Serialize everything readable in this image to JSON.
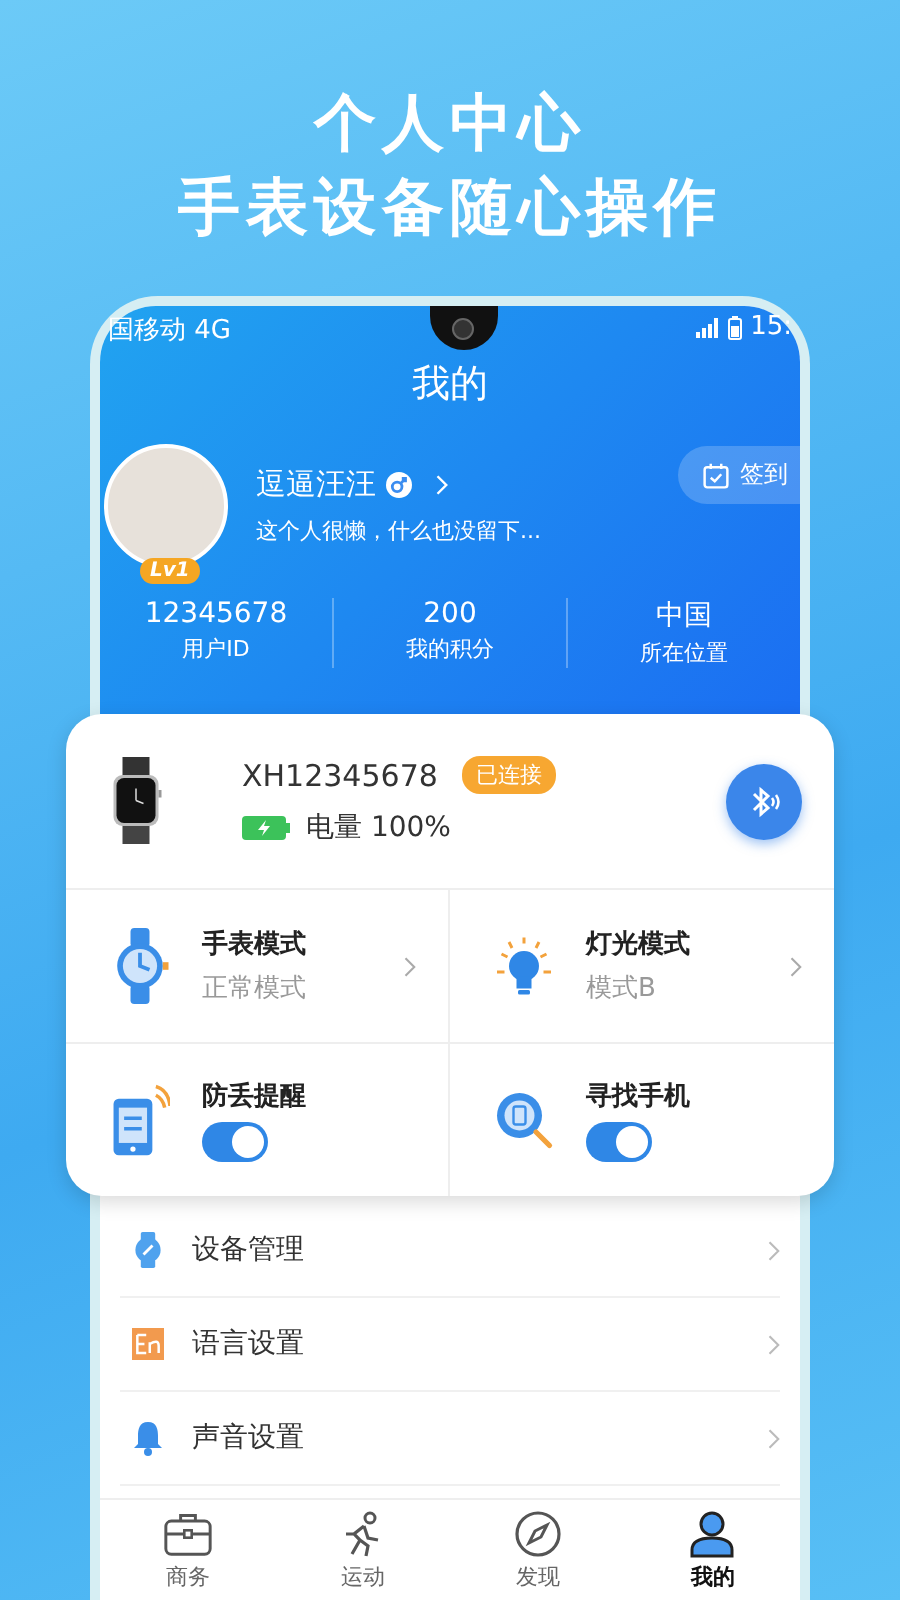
{
  "headline": [
    "个人中心",
    "手表设备随心操作"
  ],
  "status_bar": {
    "carrier": "国移动 4G",
    "time": "15:"
  },
  "title": "我的",
  "profile": {
    "name": "逗逼汪汪",
    "bio": "这个人很懒，什么也没留下...",
    "level": "Lv1",
    "checkin": "签到"
  },
  "stats": [
    {
      "value": "12345678",
      "label": "用户ID"
    },
    {
      "value": "200",
      "label": "我的积分"
    },
    {
      "value": "中国",
      "label": "所在位置"
    }
  ],
  "device": {
    "model": "XH12345678",
    "status": "已连接",
    "battery": "电量 100%"
  },
  "features": [
    {
      "kind": "mode",
      "title": "手表模式",
      "value": "正常模式"
    },
    {
      "kind": "mode",
      "title": "灯光模式",
      "value": "模式B"
    },
    {
      "kind": "toggle",
      "title": "防丢提醒",
      "on": true
    },
    {
      "kind": "toggle",
      "title": "寻找手机",
      "on": true
    }
  ],
  "menu": [
    {
      "label": "设备管理"
    },
    {
      "label": "语言设置"
    },
    {
      "label": "声音设置"
    }
  ],
  "tabs": [
    {
      "label": "商务",
      "selected": false
    },
    {
      "label": "运动",
      "selected": false
    },
    {
      "label": "发现",
      "selected": false
    },
    {
      "label": "我的",
      "selected": true
    }
  ]
}
